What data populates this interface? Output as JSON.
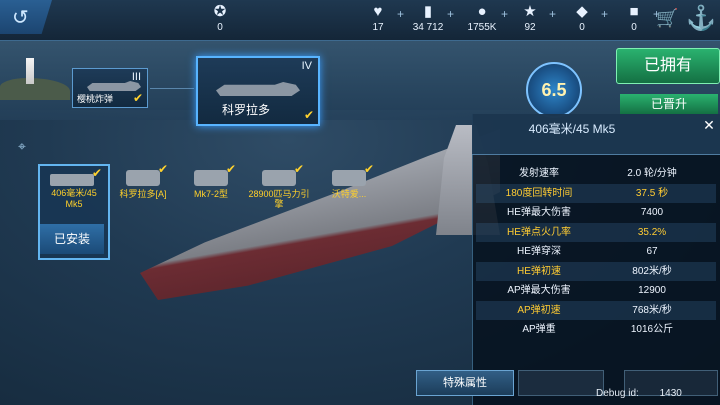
{
  "topbar": {
    "rank_value": "0",
    "resources": [
      {
        "icon": "heart-icon",
        "glyph": "♥",
        "value": "17"
      },
      {
        "icon": "card-icon",
        "glyph": "▮",
        "value": "34 712"
      },
      {
        "icon": "gold-coin-icon",
        "glyph": "●",
        "value": "1755K"
      },
      {
        "icon": "star-icon",
        "glyph": "★",
        "value": "92"
      },
      {
        "icon": "diamond-icon",
        "glyph": "◆",
        "value": "0"
      },
      {
        "icon": "cube-icon",
        "glyph": "■",
        "value": "0"
      }
    ]
  },
  "ships": {
    "previous": {
      "tier": "III",
      "name": "樱桃炸弹"
    },
    "current": {
      "tier": "IV",
      "name": "科罗拉多"
    }
  },
  "power_value": "6.5",
  "owned_button": "已拥有",
  "promoted_button": "已晋升",
  "equipment": {
    "selected": {
      "name": "406毫米/45 Mk5",
      "status": "已安装"
    },
    "items": [
      {
        "name": "科罗拉多[A]"
      },
      {
        "name": "Mk7-2型"
      },
      {
        "name": "28900匹马力引擎"
      },
      {
        "name": "沃特爱..."
      }
    ]
  },
  "stats_panel": {
    "title": "406毫米/45 Mk5",
    "rows": [
      {
        "label": "发射速率",
        "value": "2.0 轮/分钟",
        "label_color": "white",
        "value_color": "white"
      },
      {
        "label": "180度回转时间",
        "value": "37.5 秒",
        "label_color": "yellow",
        "value_color": "yellow"
      },
      {
        "label": "HE弹最大伤害",
        "value": "7400",
        "label_color": "white",
        "value_color": "white"
      },
      {
        "label": "HE弹点火几率",
        "value": "35.2%",
        "label_color": "yellow",
        "value_color": "yellow"
      },
      {
        "label": "HE弹穿深",
        "value": "67",
        "label_color": "white",
        "value_color": "white"
      },
      {
        "label": "HE弹初速",
        "value": "802米/秒",
        "label_color": "yellow",
        "value_color": "white"
      },
      {
        "label": "AP弹最大伤害",
        "value": "12900",
        "label_color": "white",
        "value_color": "white"
      },
      {
        "label": "AP弹初速",
        "value": "768米/秒",
        "label_color": "yellow",
        "value_color": "white"
      },
      {
        "label": "AP弹重",
        "value": "1016公斤",
        "label_color": "white",
        "value_color": "white"
      }
    ]
  },
  "bottom": {
    "special_button": "特殊属性",
    "debug_label": "Debug id:",
    "debug_value": "1430"
  }
}
